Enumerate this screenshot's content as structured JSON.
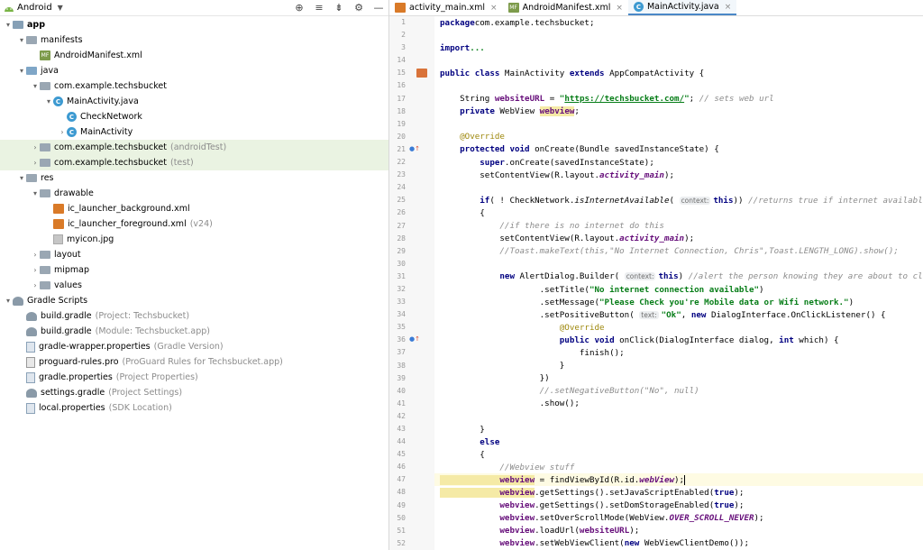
{
  "project_panel": {
    "view_label": "Android",
    "toolbar_icons": [
      "locate-icon",
      "expand-all-icon",
      "collapse-all-icon",
      "settings-icon",
      "hide-icon"
    ],
    "tree": [
      {
        "label": "app",
        "indent": 0,
        "arrow": "▾",
        "icon": "module",
        "bold": true
      },
      {
        "label": "manifests",
        "indent": 1,
        "arrow": "▾",
        "icon": "folder"
      },
      {
        "label": "AndroidManifest.xml",
        "indent": 2,
        "arrow": "",
        "icon": "manifest"
      },
      {
        "label": "java",
        "indent": 1,
        "arrow": "▾",
        "icon": "folder-blue"
      },
      {
        "label": "com.example.techsbucket",
        "indent": 2,
        "arrow": "▾",
        "icon": "folder"
      },
      {
        "label": "MainActivity.java",
        "indent": 3,
        "arrow": "▾",
        "icon": "class"
      },
      {
        "label": "CheckNetwork",
        "indent": 4,
        "arrow": "",
        "icon": "class"
      },
      {
        "label": "MainActivity",
        "indent": 4,
        "arrow": "›",
        "icon": "class"
      },
      {
        "label": "com.example.techsbucket",
        "suffix": "(androidTest)",
        "indent": 2,
        "arrow": "›",
        "icon": "folder",
        "highlight": true
      },
      {
        "label": "com.example.techsbucket",
        "suffix": "(test)",
        "indent": 2,
        "arrow": "›",
        "icon": "folder",
        "highlight": true
      },
      {
        "label": "res",
        "indent": 1,
        "arrow": "▾",
        "icon": "folder"
      },
      {
        "label": "drawable",
        "indent": 2,
        "arrow": "▾",
        "icon": "folder"
      },
      {
        "label": "ic_launcher_background.xml",
        "indent": 3,
        "arrow": "",
        "icon": "xml"
      },
      {
        "label": "ic_launcher_foreground.xml",
        "suffix": "(v24)",
        "indent": 3,
        "arrow": "",
        "icon": "xml"
      },
      {
        "label": "myicon.jpg",
        "indent": 3,
        "arrow": "",
        "icon": "image"
      },
      {
        "label": "layout",
        "indent": 2,
        "arrow": "›",
        "icon": "folder"
      },
      {
        "label": "mipmap",
        "indent": 2,
        "arrow": "›",
        "icon": "folder"
      },
      {
        "label": "values",
        "indent": 2,
        "arrow": "›",
        "icon": "folder"
      },
      {
        "label": "Gradle Scripts",
        "indent": 0,
        "arrow": "▾",
        "icon": "gradle"
      },
      {
        "label": "build.gradle",
        "suffix": "(Project: Techsbucket)",
        "indent": 1,
        "arrow": "",
        "icon": "gradle"
      },
      {
        "label": "build.gradle",
        "suffix": "(Module: Techsbucket.app)",
        "indent": 1,
        "arrow": "",
        "icon": "gradle"
      },
      {
        "label": "gradle-wrapper.properties",
        "suffix": "(Gradle Version)",
        "indent": 1,
        "arrow": "",
        "icon": "props"
      },
      {
        "label": "proguard-rules.pro",
        "suffix": "(ProGuard Rules for Techsbucket.app)",
        "indent": 1,
        "arrow": "",
        "icon": "file"
      },
      {
        "label": "gradle.properties",
        "suffix": "(Project Properties)",
        "indent": 1,
        "arrow": "",
        "icon": "props"
      },
      {
        "label": "settings.gradle",
        "suffix": "(Project Settings)",
        "indent": 1,
        "arrow": "",
        "icon": "gradle"
      },
      {
        "label": "local.properties",
        "suffix": "(SDK Location)",
        "indent": 1,
        "arrow": "",
        "icon": "props"
      }
    ]
  },
  "tabs": [
    {
      "label": "activity_main.xml",
      "icon": "xml",
      "active": false
    },
    {
      "label": "AndroidManifest.xml",
      "icon": "manifest",
      "active": false
    },
    {
      "label": "MainActivity.java",
      "icon": "class",
      "active": true
    }
  ],
  "editor": {
    "lines": [
      {
        "n": "1",
        "tokens": [
          [
            "kw",
            "package"
          ],
          [
            "",
            "com.example.techsbucket;"
          ]
        ]
      },
      {
        "n": "2",
        "tokens": []
      },
      {
        "n": "3",
        "tokens": [
          [
            "kw",
            "import"
          ],
          [
            "",
            ""
          ],
          [
            "str",
            "..."
          ]
        ]
      },
      {
        "n": "14",
        "tokens": []
      },
      {
        "n": "15",
        "mark": "class",
        "tokens": [
          [
            "kw",
            "public class"
          ],
          [
            "",
            " MainActivity "
          ],
          [
            "kw",
            "extends"
          ],
          [
            "",
            " AppCompatActivity {"
          ]
        ]
      },
      {
        "n": "16",
        "tokens": []
      },
      {
        "n": "17",
        "tokens": [
          [
            "",
            "    String "
          ],
          [
            "fld",
            "websiteURL"
          ],
          [
            "",
            " = "
          ],
          [
            "str",
            "\""
          ],
          [
            "url",
            "https://techsbucket.com/"
          ],
          [
            "str",
            "\""
          ],
          [
            "",
            "; "
          ],
          [
            "cmt",
            "// sets web url"
          ]
        ]
      },
      {
        "n": "18",
        "tokens": [
          [
            "kw",
            "    private"
          ],
          [
            "",
            " WebView "
          ],
          [
            "fld varhl",
            "webview"
          ],
          [
            ";",
            ";"
          ]
        ]
      },
      {
        "n": "19",
        "tokens": []
      },
      {
        "n": "20",
        "tokens": [
          [
            "ann",
            "    @Override"
          ]
        ]
      },
      {
        "n": "21",
        "mark": "override",
        "tokens": [
          [
            "kw",
            "    protected void"
          ],
          [
            "",
            " onCreate(Bundle savedInstanceState) {"
          ]
        ]
      },
      {
        "n": "22",
        "tokens": [
          [
            "kw",
            "        super"
          ],
          [
            "",
            ".onCreate(savedInstanceState);"
          ]
        ]
      },
      {
        "n": "23",
        "tokens": [
          [
            "",
            "        setContentView(R.layout."
          ],
          [
            "italfld",
            "activity_main"
          ],
          [
            "",
            ");"
          ]
        ]
      },
      {
        "n": "24",
        "tokens": []
      },
      {
        "n": "25",
        "tokens": [
          [
            "kw",
            "        if"
          ],
          [
            "",
            "( ! CheckNetwork."
          ],
          [
            "ital",
            "isInternetAvailable"
          ],
          [
            "",
            "( "
          ],
          [
            "hint",
            "context:"
          ],
          [
            "kw",
            "this"
          ],
          [
            "",
            "))"
          ],
          [
            "",
            " "
          ],
          [
            "cmt",
            "//returns true if internet available"
          ]
        ]
      },
      {
        "n": "26",
        "tokens": [
          [
            "",
            "        {"
          ]
        ]
      },
      {
        "n": "27",
        "tokens": [
          [
            "cmt",
            "            //if there is no internet do this"
          ]
        ]
      },
      {
        "n": "28",
        "tokens": [
          [
            "",
            "            setContentView(R.layout."
          ],
          [
            "italfld",
            "activity_main"
          ],
          [
            "",
            ");"
          ]
        ]
      },
      {
        "n": "29",
        "tokens": [
          [
            "cmt",
            "            //Toast.makeText(this,\"No Internet Connection, Chris\",Toast.LENGTH_LONG).show();"
          ]
        ]
      },
      {
        "n": "30",
        "tokens": []
      },
      {
        "n": "31",
        "tokens": [
          [
            "kw",
            "            new"
          ],
          [
            "",
            " AlertDialog.Builder( "
          ],
          [
            "hint",
            "context:"
          ],
          [
            "kw",
            "this"
          ],
          [
            "",
            ") "
          ],
          [
            "cmt",
            "//alert the person knowing they are about to close"
          ]
        ]
      },
      {
        "n": "32",
        "tokens": [
          [
            "",
            "                    .setTitle("
          ],
          [
            "str",
            "\"No internet connection available\""
          ],
          [
            "",
            ")"
          ]
        ]
      },
      {
        "n": "33",
        "tokens": [
          [
            "",
            "                    .setMessage("
          ],
          [
            "str",
            "\"Please Check you're Mobile data or Wifi network.\""
          ],
          [
            "",
            ")"
          ]
        ]
      },
      {
        "n": "34",
        "tokens": [
          [
            "",
            "                    .setPositiveButton( "
          ],
          [
            "hint",
            "text:"
          ],
          [
            "str",
            "\"Ok\""
          ],
          [
            "",
            ", "
          ],
          [
            "kw",
            "new"
          ],
          [
            "",
            " DialogInterface.OnClickListener() {"
          ]
        ]
      },
      {
        "n": "35",
        "tokens": [
          [
            "ann",
            "                        @Override"
          ]
        ]
      },
      {
        "n": "36",
        "mark": "override",
        "tokens": [
          [
            "kw",
            "                        public void"
          ],
          [
            "",
            " onClick(DialogInterface dialog, "
          ],
          [
            "kw",
            "int"
          ],
          [
            "",
            " which) {"
          ]
        ]
      },
      {
        "n": "37",
        "tokens": [
          [
            "",
            "                            finish();"
          ]
        ]
      },
      {
        "n": "38",
        "tokens": [
          [
            "",
            "                        }"
          ]
        ]
      },
      {
        "n": "39",
        "tokens": [
          [
            "",
            "                    })"
          ]
        ]
      },
      {
        "n": "40",
        "tokens": [
          [
            "cmt",
            "                    //.setNegativeButton(\"No\", null)"
          ]
        ]
      },
      {
        "n": "41",
        "tokens": [
          [
            "",
            "                    .show();"
          ]
        ]
      },
      {
        "n": "42",
        "tokens": []
      },
      {
        "n": "43",
        "tokens": [
          [
            "",
            "        }"
          ]
        ]
      },
      {
        "n": "44",
        "tokens": [
          [
            "kw",
            "        else"
          ]
        ]
      },
      {
        "n": "45",
        "tokens": [
          [
            "",
            "        {"
          ]
        ]
      },
      {
        "n": "46",
        "tokens": [
          [
            "cmt",
            "            //Webview stuff"
          ]
        ]
      },
      {
        "n": "47",
        "current": true,
        "tokens": [
          [
            "fld varhl",
            "            webview"
          ],
          [
            "",
            " = findViewById(R.id."
          ],
          [
            "italfld",
            "webView"
          ],
          [
            "",
            ");"
          ]
        ]
      },
      {
        "n": "48",
        "tokens": [
          [
            "fld varhl",
            "            webview"
          ],
          [
            "",
            ".getSettings().setJavaScriptEnabled("
          ],
          [
            "kw",
            "true"
          ],
          [
            "",
            ");"
          ]
        ]
      },
      {
        "n": "49",
        "tokens": [
          [
            "fld",
            "            webview"
          ],
          [
            "",
            ".getSettings().setDomStorageEnabled("
          ],
          [
            "kw",
            "true"
          ],
          [
            "",
            ");"
          ]
        ]
      },
      {
        "n": "50",
        "tokens": [
          [
            "fld",
            "            webview"
          ],
          [
            "",
            ".setOverScrollMode(WebView."
          ],
          [
            "italfld",
            "OVER_SCROLL_NEVER"
          ],
          [
            "",
            ");"
          ]
        ]
      },
      {
        "n": "51",
        "tokens": [
          [
            "fld",
            "            webview"
          ],
          [
            "",
            ".loadUrl("
          ],
          [
            "fld",
            "websiteURL"
          ],
          [
            "",
            ");"
          ]
        ]
      },
      {
        "n": "52",
        "tokens": [
          [
            "fld",
            "            webview"
          ],
          [
            "",
            ".setWebViewClient("
          ],
          [
            "kw",
            "new"
          ],
          [
            "",
            " WebViewClientDemo());"
          ]
        ]
      }
    ]
  }
}
